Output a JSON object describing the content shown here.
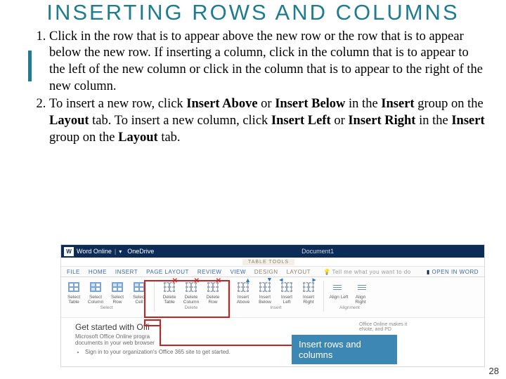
{
  "title": "INSERTING ROWS AND COLUMNS",
  "steps": {
    "s1": "Click in the row that is to appear above the new row or the row that is to appear below the new row. If inserting a column, click in the column that is to appear to the left of the new column or click in the column that is to appear to the right of the new column.",
    "s2_a": "To insert a new row, click ",
    "s2_b": " or ",
    "s2_c": " in the ",
    "s2_d": " group on the ",
    "s2_e": " tab. To insert a new column, click ",
    "s2_f": " or ",
    "s2_g": " in the ",
    "s2_h": " group on the ",
    "s2_i": " tab.",
    "insert_above": "Insert Above",
    "insert_below": "Insert Below",
    "insert_group": "Insert",
    "layout_tab": "Layout",
    "insert_left": "Insert Left",
    "insert_right": "Insert Right"
  },
  "word": {
    "app": "Word Online",
    "location": "OneDrive",
    "doc": "Document1",
    "context": "TABLE TOOLS",
    "tabs": {
      "file": "FILE",
      "home": "HOME",
      "insert": "INSERT",
      "pagelayout": "PAGE LAYOUT",
      "review": "REVIEW",
      "view": "VIEW",
      "design": "DESIGN",
      "layout": "LAYOUT"
    },
    "tellme": "Tell me what you want to do",
    "openin": "OPEN IN WORD",
    "groups": {
      "select": "Select",
      "delete": "Delete",
      "insert": "Insert",
      "alignment": "Alignment"
    },
    "cmds": {
      "sel_table": "Select Table",
      "sel_column": "Select Column",
      "sel_row": "Select Row",
      "sel_cell": "Select Cell",
      "del_table": "Delete Table",
      "del_column": "Delete Column",
      "del_row": "Delete Row",
      "ins_above": "Insert Above",
      "ins_below": "Insert Below",
      "ins_left": "Insert Left",
      "ins_right": "Insert Right",
      "align_left": "Align Left",
      "align_right": "Align Right"
    },
    "doc_heading": "Get started with Offi",
    "doc_line1": "Microsoft Office Online progra",
    "doc_line2": "documents in your web browser",
    "doc_bullet": "Sign in to your organization's Office 365 site to get started.",
    "doc_right1": "Office Online makes it",
    "doc_right2": "eNote, and PD"
  },
  "callout": "Insert rows and columns",
  "page_number": "28"
}
